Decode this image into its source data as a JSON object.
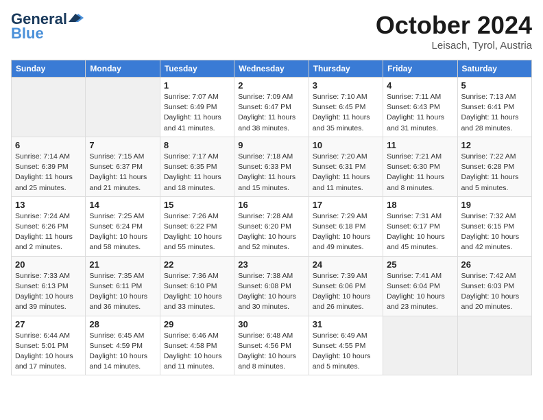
{
  "header": {
    "logo_line1": "General",
    "logo_line2": "Blue",
    "month_title": "October 2024",
    "location": "Leisach, Tyrol, Austria"
  },
  "weekdays": [
    "Sunday",
    "Monday",
    "Tuesday",
    "Wednesday",
    "Thursday",
    "Friday",
    "Saturday"
  ],
  "weeks": [
    [
      {
        "day": "",
        "info": ""
      },
      {
        "day": "",
        "info": ""
      },
      {
        "day": "1",
        "info": "Sunrise: 7:07 AM\nSunset: 6:49 PM\nDaylight: 11 hours and 41 minutes."
      },
      {
        "day": "2",
        "info": "Sunrise: 7:09 AM\nSunset: 6:47 PM\nDaylight: 11 hours and 38 minutes."
      },
      {
        "day": "3",
        "info": "Sunrise: 7:10 AM\nSunset: 6:45 PM\nDaylight: 11 hours and 35 minutes."
      },
      {
        "day": "4",
        "info": "Sunrise: 7:11 AM\nSunset: 6:43 PM\nDaylight: 11 hours and 31 minutes."
      },
      {
        "day": "5",
        "info": "Sunrise: 7:13 AM\nSunset: 6:41 PM\nDaylight: 11 hours and 28 minutes."
      }
    ],
    [
      {
        "day": "6",
        "info": "Sunrise: 7:14 AM\nSunset: 6:39 PM\nDaylight: 11 hours and 25 minutes."
      },
      {
        "day": "7",
        "info": "Sunrise: 7:15 AM\nSunset: 6:37 PM\nDaylight: 11 hours and 21 minutes."
      },
      {
        "day": "8",
        "info": "Sunrise: 7:17 AM\nSunset: 6:35 PM\nDaylight: 11 hours and 18 minutes."
      },
      {
        "day": "9",
        "info": "Sunrise: 7:18 AM\nSunset: 6:33 PM\nDaylight: 11 hours and 15 minutes."
      },
      {
        "day": "10",
        "info": "Sunrise: 7:20 AM\nSunset: 6:31 PM\nDaylight: 11 hours and 11 minutes."
      },
      {
        "day": "11",
        "info": "Sunrise: 7:21 AM\nSunset: 6:30 PM\nDaylight: 11 hours and 8 minutes."
      },
      {
        "day": "12",
        "info": "Sunrise: 7:22 AM\nSunset: 6:28 PM\nDaylight: 11 hours and 5 minutes."
      }
    ],
    [
      {
        "day": "13",
        "info": "Sunrise: 7:24 AM\nSunset: 6:26 PM\nDaylight: 11 hours and 2 minutes."
      },
      {
        "day": "14",
        "info": "Sunrise: 7:25 AM\nSunset: 6:24 PM\nDaylight: 10 hours and 58 minutes."
      },
      {
        "day": "15",
        "info": "Sunrise: 7:26 AM\nSunset: 6:22 PM\nDaylight: 10 hours and 55 minutes."
      },
      {
        "day": "16",
        "info": "Sunrise: 7:28 AM\nSunset: 6:20 PM\nDaylight: 10 hours and 52 minutes."
      },
      {
        "day": "17",
        "info": "Sunrise: 7:29 AM\nSunset: 6:18 PM\nDaylight: 10 hours and 49 minutes."
      },
      {
        "day": "18",
        "info": "Sunrise: 7:31 AM\nSunset: 6:17 PM\nDaylight: 10 hours and 45 minutes."
      },
      {
        "day": "19",
        "info": "Sunrise: 7:32 AM\nSunset: 6:15 PM\nDaylight: 10 hours and 42 minutes."
      }
    ],
    [
      {
        "day": "20",
        "info": "Sunrise: 7:33 AM\nSunset: 6:13 PM\nDaylight: 10 hours and 39 minutes."
      },
      {
        "day": "21",
        "info": "Sunrise: 7:35 AM\nSunset: 6:11 PM\nDaylight: 10 hours and 36 minutes."
      },
      {
        "day": "22",
        "info": "Sunrise: 7:36 AM\nSunset: 6:10 PM\nDaylight: 10 hours and 33 minutes."
      },
      {
        "day": "23",
        "info": "Sunrise: 7:38 AM\nSunset: 6:08 PM\nDaylight: 10 hours and 30 minutes."
      },
      {
        "day": "24",
        "info": "Sunrise: 7:39 AM\nSunset: 6:06 PM\nDaylight: 10 hours and 26 minutes."
      },
      {
        "day": "25",
        "info": "Sunrise: 7:41 AM\nSunset: 6:04 PM\nDaylight: 10 hours and 23 minutes."
      },
      {
        "day": "26",
        "info": "Sunrise: 7:42 AM\nSunset: 6:03 PM\nDaylight: 10 hours and 20 minutes."
      }
    ],
    [
      {
        "day": "27",
        "info": "Sunrise: 6:44 AM\nSunset: 5:01 PM\nDaylight: 10 hours and 17 minutes."
      },
      {
        "day": "28",
        "info": "Sunrise: 6:45 AM\nSunset: 4:59 PM\nDaylight: 10 hours and 14 minutes."
      },
      {
        "day": "29",
        "info": "Sunrise: 6:46 AM\nSunset: 4:58 PM\nDaylight: 10 hours and 11 minutes."
      },
      {
        "day": "30",
        "info": "Sunrise: 6:48 AM\nSunset: 4:56 PM\nDaylight: 10 hours and 8 minutes."
      },
      {
        "day": "31",
        "info": "Sunrise: 6:49 AM\nSunset: 4:55 PM\nDaylight: 10 hours and 5 minutes."
      },
      {
        "day": "",
        "info": ""
      },
      {
        "day": "",
        "info": ""
      }
    ]
  ]
}
